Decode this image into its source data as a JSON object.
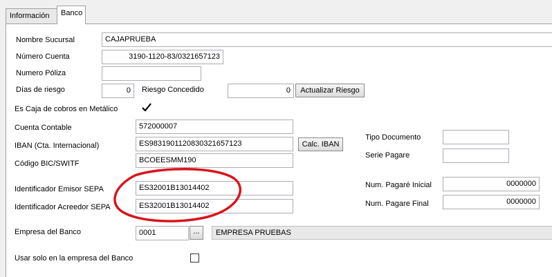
{
  "tabs": [
    {
      "label": "Información"
    },
    {
      "label": "Banco"
    }
  ],
  "form": {
    "nombre_sucursal": {
      "label": "Nombre Sucursal",
      "value": "CAJAPRUEBA"
    },
    "numero_cuenta": {
      "label": "Número Cuenta",
      "value": "3190-1120-83/0321657123"
    },
    "numero_poliza": {
      "label": "Numero Póliza",
      "value": ""
    },
    "dias_riesgo": {
      "label": "Días de riesgo",
      "value": "0"
    },
    "riesgo_concedido": {
      "label": "Riesgo Concedido",
      "value": "0"
    },
    "actualizar_riesgo": {
      "label": "Actualizar Riesgo"
    },
    "caja_metalico": {
      "label": "Es Caja de cobros en Metálico",
      "checked": true
    },
    "cuenta_contable": {
      "label": "Cuenta Contable",
      "value": "572000007"
    },
    "iban": {
      "label": "IBAN (Cta. Internacional)",
      "value": "ES9831901120830321657123"
    },
    "calc_iban": {
      "label": "Calc. IBAN"
    },
    "bic": {
      "label": "Código BIC/SWITF",
      "value": "BCOEESMM190"
    },
    "emisor_sepa": {
      "label": "Identificador Emisor SEPA",
      "value": "ES32001B13014402"
    },
    "acreedor_sepa": {
      "label": "Identificador Acreedor SEPA",
      "value": "ES32001B13014402"
    },
    "empresa_banco": {
      "label": "Empresa del Banco",
      "code": "0001",
      "browse": "...",
      "name": "EMPRESA PRUEBAS"
    },
    "usar_solo": {
      "label": "Usar solo en la empresa del Banco",
      "checked": false
    },
    "tipo_documento": {
      "label": "Tipo Documento",
      "value": ""
    },
    "serie_pagare": {
      "label": "Serie Pagare",
      "value": ""
    },
    "pagare_inicial": {
      "label": "Num. Pagaré Inicial",
      "value": "0000000"
    },
    "pagare_final": {
      "label": "Num. Pagare Final",
      "value": "0000000"
    }
  },
  "colors": {
    "annotation": "#d8151d",
    "check": "#000000"
  }
}
